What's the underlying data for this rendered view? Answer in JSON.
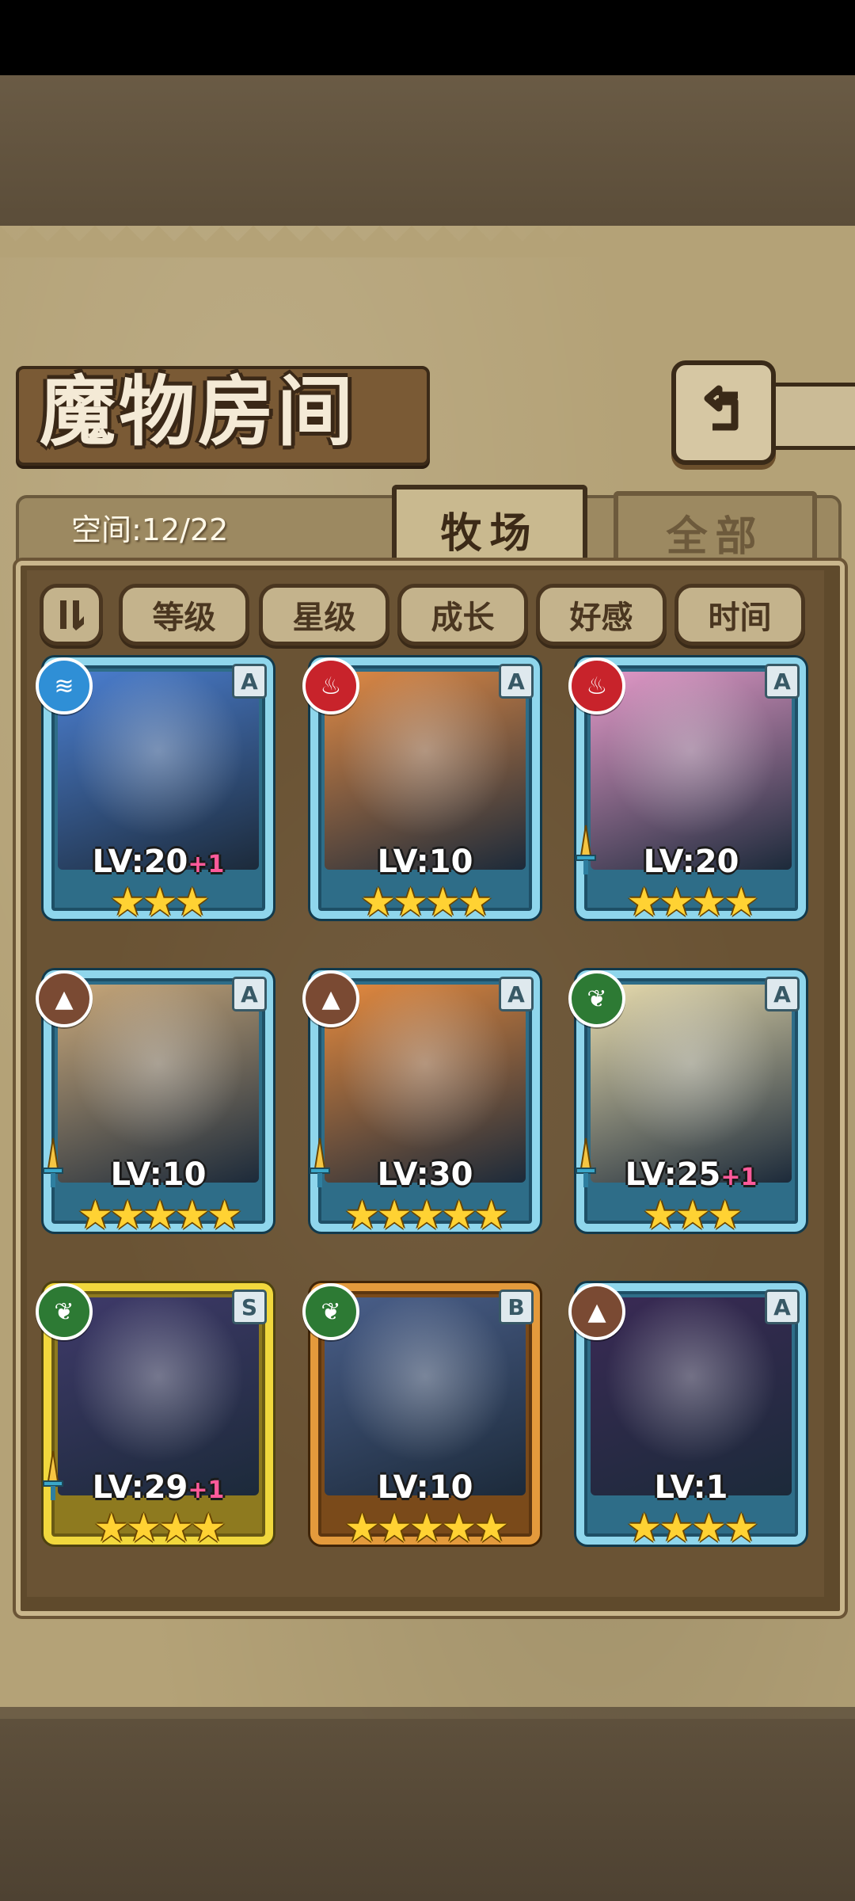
{
  "header": {
    "title": "魔物房间",
    "back_icon": "back-arrow-icon"
  },
  "tabs": {
    "space_label": "空间:12/22",
    "active": "牧场",
    "inactive": "全部"
  },
  "sort": {
    "toggle_icon": "sort-order-icon",
    "options": [
      "等级",
      "星级",
      "成长",
      "好感",
      "时间"
    ]
  },
  "monsters": [
    {
      "element": "water",
      "rank": "A",
      "level": "LV:20",
      "bonus": "+1",
      "stars": "★★★",
      "frame": "blue",
      "portrait_color": "#4b7fd1"
    },
    {
      "element": "fire",
      "rank": "A",
      "level": "LV:10",
      "bonus": "",
      "stars": "★★★★",
      "frame": "blue",
      "portrait_color": "#e08a45"
    },
    {
      "element": "fire",
      "rank": "A",
      "level": "LV:20",
      "bonus": "",
      "stars": "★★★★",
      "frame": "blue",
      "portrait_color": "#e49ac9"
    },
    {
      "element": "earth",
      "rank": "A",
      "level": "LV:10",
      "bonus": "",
      "stars": "★★★★★",
      "frame": "blue",
      "portrait_color": "#c9a87a"
    },
    {
      "element": "earth",
      "rank": "A",
      "level": "LV:30",
      "bonus": "",
      "stars": "★★★★★",
      "frame": "blue",
      "portrait_color": "#e58a3e"
    },
    {
      "element": "wood",
      "rank": "A",
      "level": "LV:25",
      "bonus": "+1",
      "stars": "★★★",
      "frame": "blue",
      "portrait_color": "#e8dcae"
    },
    {
      "element": "wood",
      "rank": "S",
      "level": "LV:29",
      "bonus": "+1",
      "stars": "★★★★",
      "frame": "gold",
      "portrait_color": "#3f3a6a"
    },
    {
      "element": "wood",
      "rank": "B",
      "level": "LV:10",
      "bonus": "",
      "stars": "★★★★★",
      "frame": "bronze",
      "portrait_color": "#4a5f8a"
    },
    {
      "element": "earth",
      "rank": "A",
      "level": "LV:1",
      "bonus": "",
      "stars": "★★★★",
      "frame": "blue",
      "portrait_color": "#3a2a55"
    }
  ],
  "element_colors": {
    "water": "#2f8fd6",
    "fire": "#c8232b",
    "earth": "#7a4a33",
    "wood": "#2d7a34"
  },
  "element_glyphs": {
    "water": "≋",
    "fire": "♨",
    "earth": "▲",
    "wood": "❦"
  }
}
